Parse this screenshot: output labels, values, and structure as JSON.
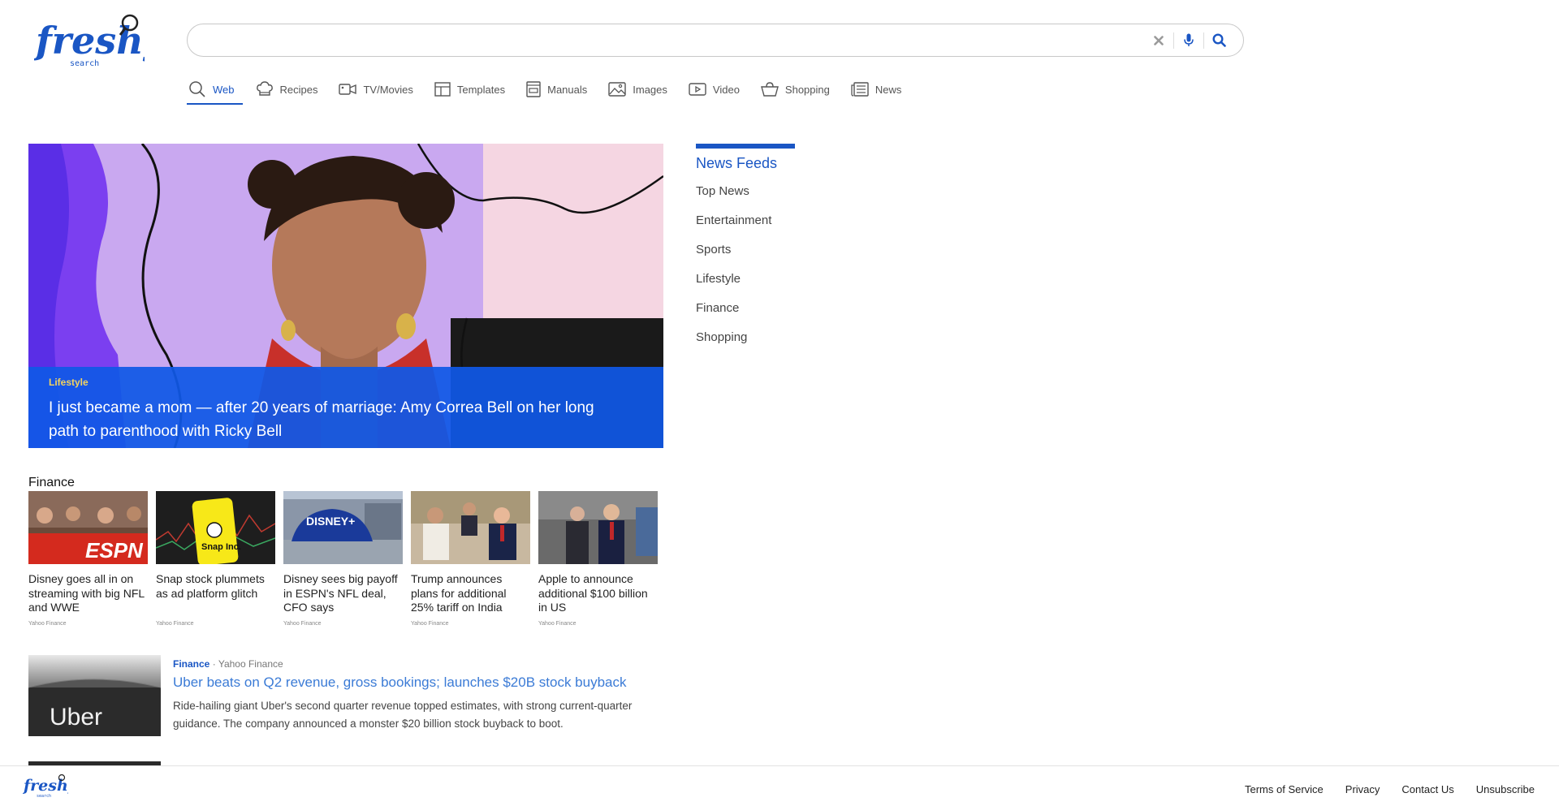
{
  "brand": {
    "name": "freshy",
    "sub": "search"
  },
  "search": {
    "value": "",
    "placeholder": ""
  },
  "tabs": [
    {
      "label": "Web",
      "icon": "search-icon",
      "active": true
    },
    {
      "label": "Recipes",
      "icon": "chef-hat-icon"
    },
    {
      "label": "TV/Movies",
      "icon": "video-camera-icon"
    },
    {
      "label": "Templates",
      "icon": "template-icon"
    },
    {
      "label": "Manuals",
      "icon": "manual-icon"
    },
    {
      "label": "Images",
      "icon": "image-icon"
    },
    {
      "label": "Video",
      "icon": "play-icon"
    },
    {
      "label": "Shopping",
      "icon": "basket-icon"
    },
    {
      "label": "News",
      "icon": "newspaper-icon"
    }
  ],
  "hero": {
    "category": "Lifestyle",
    "title": "I just became a mom — after 20 years of marriage: Amy Correa Bell on her long path to parenthood with Ricky Bell"
  },
  "finance": {
    "title": "Finance",
    "cards": [
      {
        "title": "Disney goes all in on streaming with big NFL and WWE",
        "source": "Yahoo Finance"
      },
      {
        "title": "Snap stock plummets as ad platform glitch",
        "source": "Yahoo Finance"
      },
      {
        "title": "Disney sees big payoff in ESPN's NFL deal, CFO says",
        "source": "Yahoo Finance"
      },
      {
        "title": "Trump announces plans for additional 25% tariff on India",
        "source": "Yahoo Finance"
      },
      {
        "title": "Apple to announce additional $100 billion in US",
        "source": "Yahoo Finance"
      }
    ]
  },
  "article": {
    "category": "Finance",
    "separator": "·",
    "source": "Yahoo Finance",
    "title": "Uber beats on Q2 revenue, gross bookings; launches $20B stock buyback",
    "description": "Ride-hailing giant Uber's second quarter revenue topped estimates, with strong current-quarter guidance. The company announced a monster $20 billion stock buyback to boot.",
    "thumb_text": "Uber"
  },
  "feeds": {
    "title": "News Feeds",
    "items": [
      "Top News",
      "Entertainment",
      "Sports",
      "Lifestyle",
      "Finance",
      "Shopping"
    ]
  },
  "footer": {
    "links": [
      "Terms of Service",
      "Privacy",
      "Contact Us",
      "Unsubscribe"
    ]
  },
  "colors": {
    "accent": "#1a56c4",
    "hero_caption": "#1058e6",
    "category_gold": "#f4d35e"
  }
}
